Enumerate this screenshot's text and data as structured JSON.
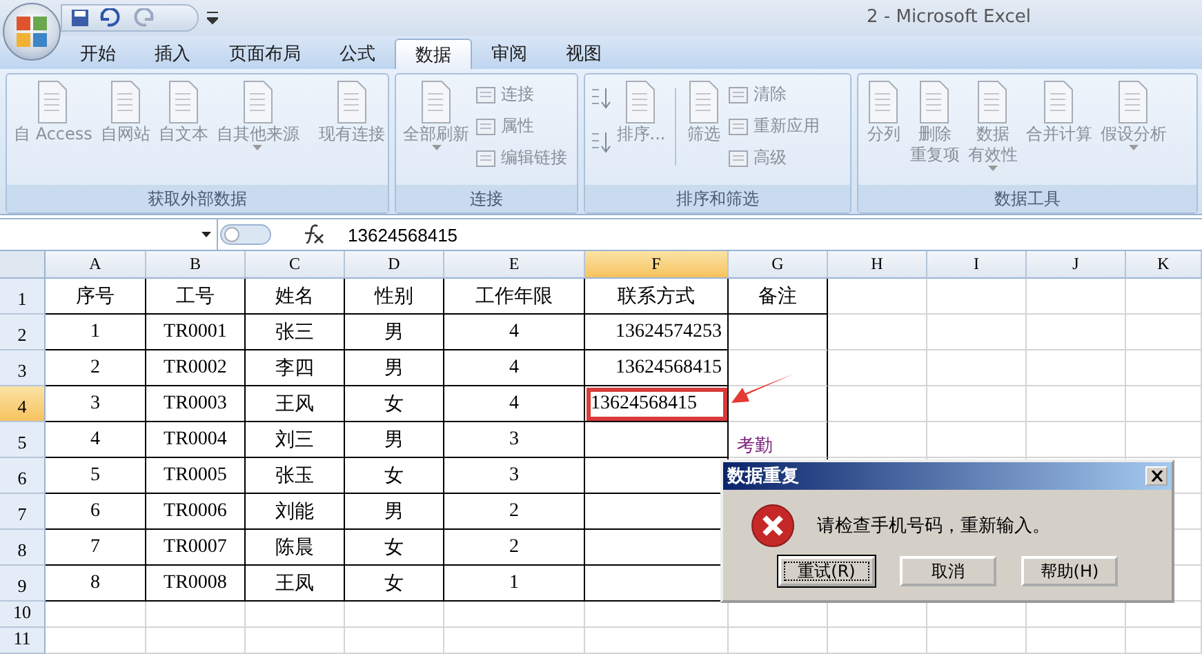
{
  "window": {
    "title": "2 - Microsoft Excel"
  },
  "tabs": [
    {
      "label": "开始",
      "selected": false
    },
    {
      "label": "插入",
      "selected": false
    },
    {
      "label": "页面布局",
      "selected": false
    },
    {
      "label": "公式",
      "selected": false
    },
    {
      "label": "数据",
      "selected": true
    },
    {
      "label": "审阅",
      "selected": false
    },
    {
      "label": "视图",
      "selected": false
    }
  ],
  "ribbon": {
    "disabled": true,
    "groups": [
      {
        "title": "获取外部数据",
        "items": [
          {
            "kind": "large",
            "lines": [
              "自 Access"
            ],
            "dropdown": false
          },
          {
            "kind": "large",
            "lines": [
              "自网站"
            ],
            "dropdown": false
          },
          {
            "kind": "large",
            "lines": [
              "自文本"
            ],
            "dropdown": false
          },
          {
            "kind": "large",
            "lines": [
              "自其他来源"
            ],
            "dropdown": true
          },
          {
            "kind": "separator"
          },
          {
            "kind": "large",
            "lines": [
              "现有连接"
            ],
            "dropdown": false
          }
        ]
      },
      {
        "title": "连接",
        "items": [
          {
            "kind": "large",
            "lines": [
              "全部刷新"
            ],
            "dropdown": true
          },
          {
            "kind": "small",
            "labels": [
              "连接",
              "属性",
              "编辑链接"
            ]
          }
        ]
      },
      {
        "title": "排序和筛选",
        "items": [
          {
            "kind": "sort"
          },
          {
            "kind": "large",
            "lines": [
              "排序..."
            ],
            "dropdown": false
          },
          {
            "kind": "separator"
          },
          {
            "kind": "large",
            "lines": [
              "筛选"
            ],
            "dropdown": false
          },
          {
            "kind": "small",
            "labels": [
              "清除",
              "重新应用",
              "高级"
            ]
          }
        ]
      },
      {
        "title": "数据工具",
        "items": [
          {
            "kind": "large",
            "lines": [
              "分列"
            ],
            "dropdown": false
          },
          {
            "kind": "large",
            "lines": [
              "删除",
              "重复项"
            ],
            "dropdown": false
          },
          {
            "kind": "large",
            "lines": [
              "数据",
              "有效性"
            ],
            "dropdown": true
          },
          {
            "kind": "large",
            "lines": [
              "合并计算"
            ],
            "dropdown": false
          },
          {
            "kind": "large",
            "lines": [
              "假设分析"
            ],
            "dropdown": true
          }
        ]
      }
    ]
  },
  "formula_bar": {
    "value": "13624568415"
  },
  "sheet": {
    "columns": [
      {
        "label": "A",
        "selected": false
      },
      {
        "label": "B",
        "selected": false
      },
      {
        "label": "C",
        "selected": false
      },
      {
        "label": "D",
        "selected": false
      },
      {
        "label": "E",
        "selected": false
      },
      {
        "label": "F",
        "selected": true
      },
      {
        "label": "G",
        "selected": false
      },
      {
        "label": "H",
        "selected": false
      },
      {
        "label": "I",
        "selected": false
      },
      {
        "label": "J",
        "selected": false
      },
      {
        "label": "K",
        "selected": false
      }
    ],
    "rows": [
      {
        "header": "1",
        "selected": false,
        "cells": [
          "序号",
          "工号",
          "姓名",
          "性别",
          "工作年限",
          "联系方式",
          "备注"
        ]
      },
      {
        "header": "2",
        "selected": false,
        "cells": [
          "1",
          "TR0001",
          "张三",
          "男",
          "4",
          "13624574253"
        ]
      },
      {
        "header": "3",
        "selected": false,
        "cells": [
          "2",
          "TR0002",
          "李四",
          "男",
          "4",
          "13624568415"
        ]
      },
      {
        "header": "4",
        "selected": true,
        "cells": [
          "3",
          "TR0003",
          "王风",
          "女",
          "4",
          "13624568415"
        ]
      },
      {
        "header": "5",
        "selected": false,
        "cells": [
          "4",
          "TR0004",
          "刘三",
          "男",
          "3"
        ]
      },
      {
        "header": "6",
        "selected": false,
        "cells": [
          "5",
          "TR0005",
          "张玉",
          "女",
          "3"
        ]
      },
      {
        "header": "7",
        "selected": false,
        "cells": [
          "6",
          "TR0006",
          "刘能",
          "男",
          "2"
        ]
      },
      {
        "header": "8",
        "selected": false,
        "cells": [
          "7",
          "TR0007",
          "陈晨",
          "女",
          "2"
        ]
      },
      {
        "header": "9",
        "selected": false,
        "cells": [
          "8",
          "TR0008",
          "王凤",
          "女",
          "1"
        ]
      }
    ],
    "empty_rows": [
      "10",
      "11"
    ]
  },
  "note": {
    "text": "考勤"
  },
  "dialog": {
    "title": "数据重复",
    "message": "请检查手机号码，重新输入。",
    "buttons": [
      {
        "label": "重试(R)",
        "focused": true
      },
      {
        "label": "取消",
        "focused": false
      },
      {
        "label": "帮助(H)",
        "focused": false
      }
    ]
  }
}
